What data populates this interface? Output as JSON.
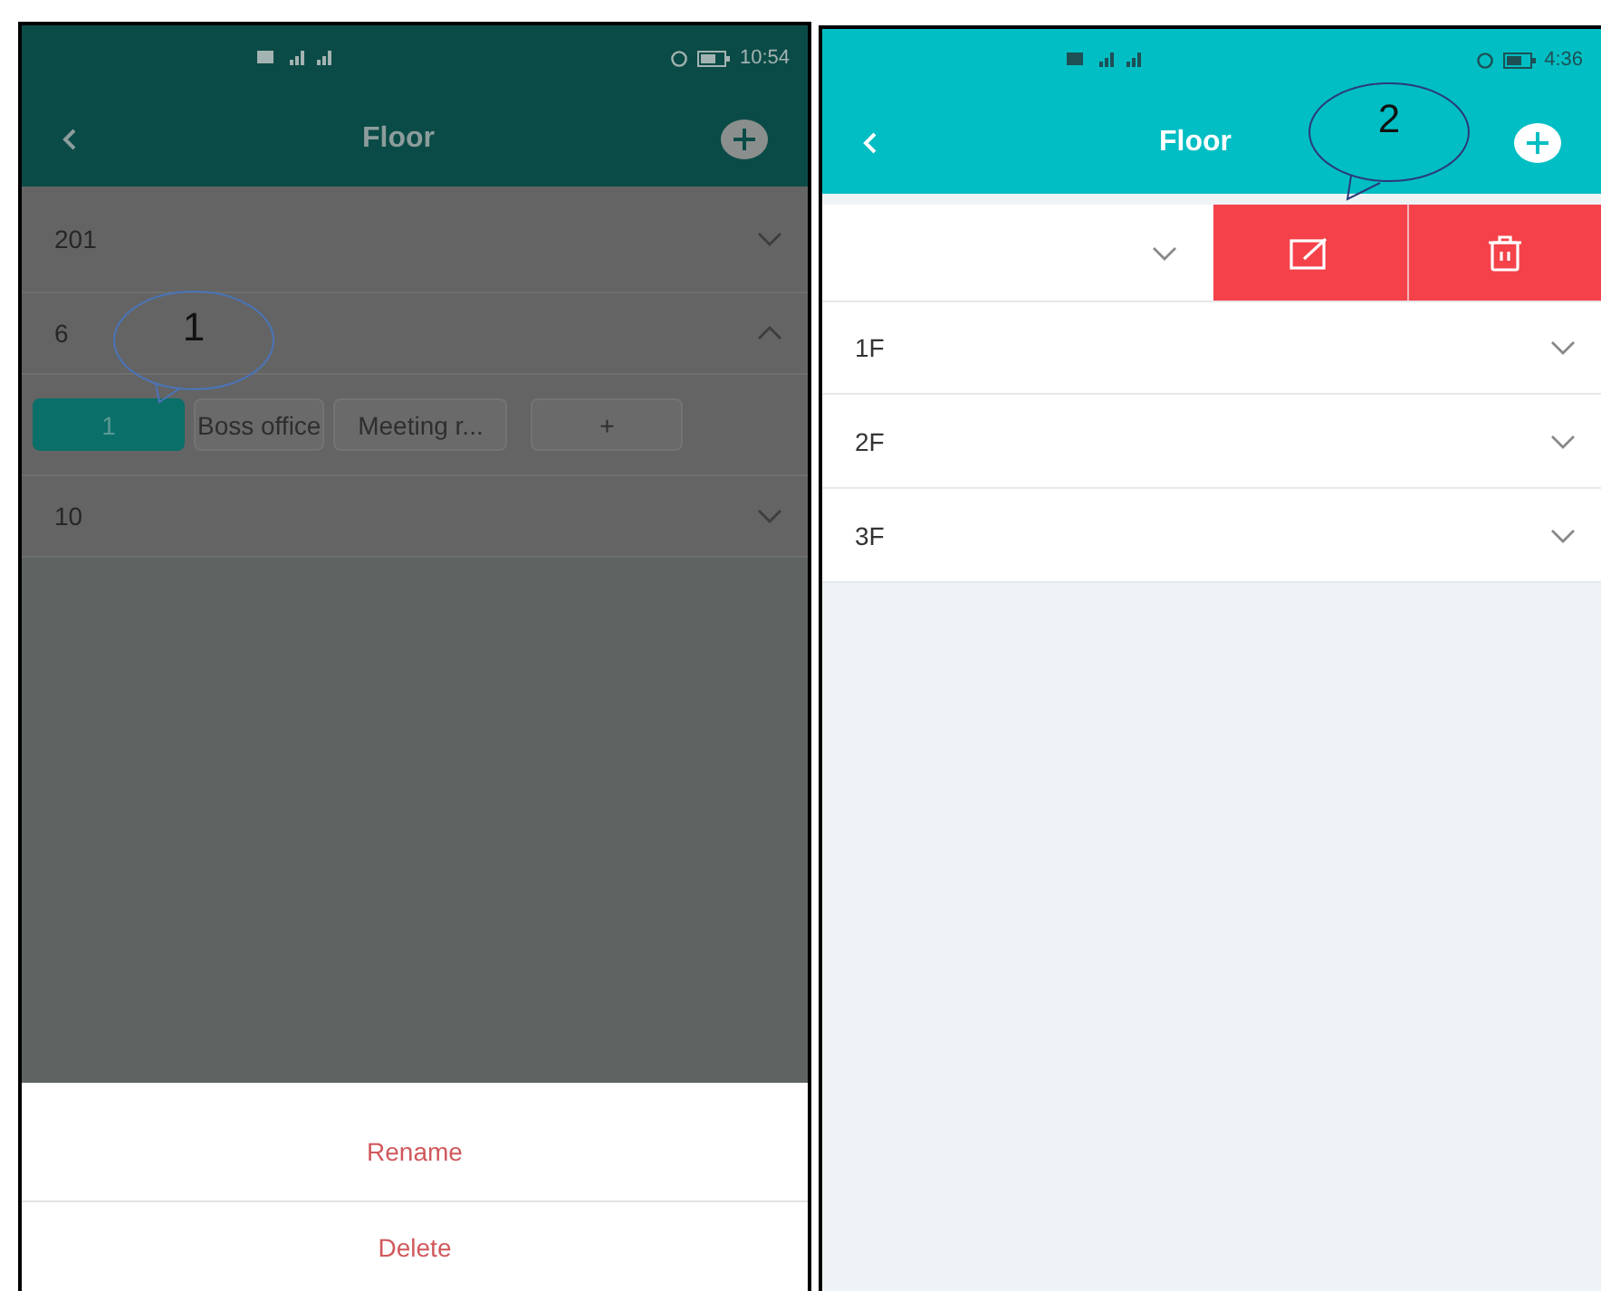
{
  "screens": [
    {
      "dimmed": true,
      "status_bar": {
        "time": "10:54"
      },
      "header": {
        "title": "Floor"
      },
      "floors": [
        {
          "name": "201",
          "expanded": false,
          "swiped": false
        },
        {
          "name": "6",
          "expanded": true,
          "swiped": false,
          "rooms": [
            {
              "name": "1",
              "selected": true
            },
            {
              "name": "Boss office",
              "selected": false
            },
            {
              "name": "Meeting r...",
              "selected": false
            }
          ],
          "add_room": "+"
        },
        {
          "name": "10",
          "expanded": false,
          "swiped": false
        }
      ],
      "callout": "1",
      "action_sheet": [
        "Rename",
        "Delete"
      ]
    },
    {
      "dimmed": false,
      "status_bar": {
        "time": "4:36"
      },
      "header": {
        "title": "Floor"
      },
      "floors": [
        {
          "expanded": false,
          "swiped": true
        },
        {
          "name": "1F",
          "expanded": false,
          "swiped": false
        },
        {
          "name": "2F",
          "expanded": false,
          "swiped": false
        },
        {
          "name": "3F",
          "expanded": false,
          "swiped": false
        }
      ],
      "callout": "2"
    }
  ]
}
